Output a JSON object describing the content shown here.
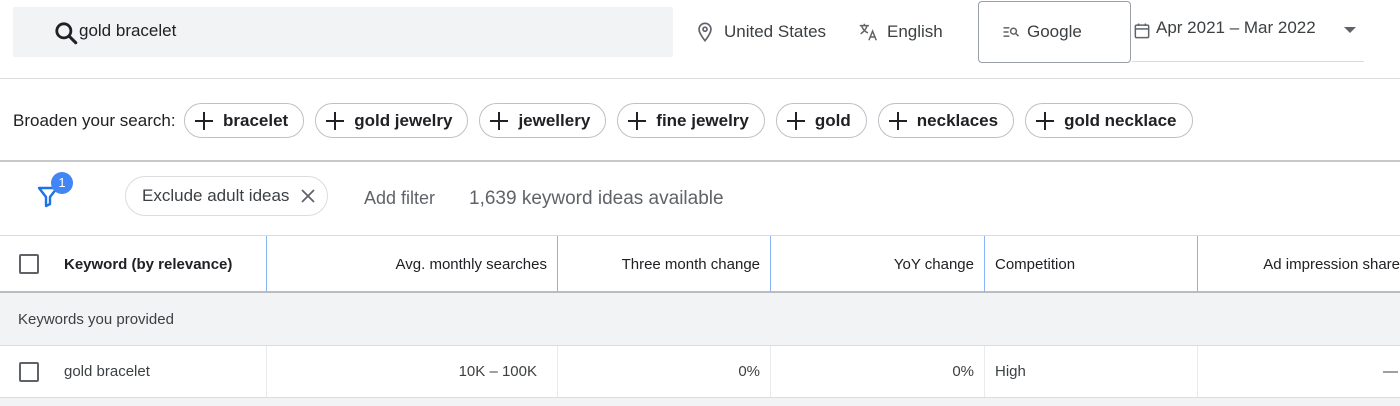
{
  "search": {
    "value": "gold bracelet"
  },
  "top": {
    "location": "United States",
    "language": "English",
    "network": "Google",
    "date_range": "Apr 2021 – Mar 2022"
  },
  "broaden": {
    "label": "Broaden your search:",
    "chips": [
      "bracelet",
      "gold jewelry",
      "jewellery",
      "fine jewelry",
      "gold",
      "necklaces",
      "gold necklace"
    ]
  },
  "filters": {
    "badge_count": "1",
    "active_chip": "Exclude adult ideas",
    "add_filter": "Add filter",
    "ideas_available": "1,639 keyword ideas available"
  },
  "table": {
    "columns": [
      "Keyword (by relevance)",
      "Avg. monthly searches",
      "Three month change",
      "YoY change",
      "Competition",
      "Ad impression share"
    ],
    "group_label": "Keywords you provided",
    "rows": [
      {
        "keyword": "gold bracelet",
        "avg_monthly": "10K – 100K",
        "three_month": "0%",
        "yoy": "0%",
        "competition": "High",
        "ad_impression": "—"
      }
    ]
  },
  "colors": {
    "accent": "#4285f4",
    "header_separator": "#8ab4f8",
    "group_bg": "#f1f3f4"
  },
  "icons": [
    "search-icon",
    "location-pin-icon",
    "translate-icon",
    "search-network-icon",
    "calendar-icon",
    "dropdown-caret-icon",
    "plus-icon",
    "filter-icon",
    "close-icon",
    "checkbox-icon"
  ]
}
